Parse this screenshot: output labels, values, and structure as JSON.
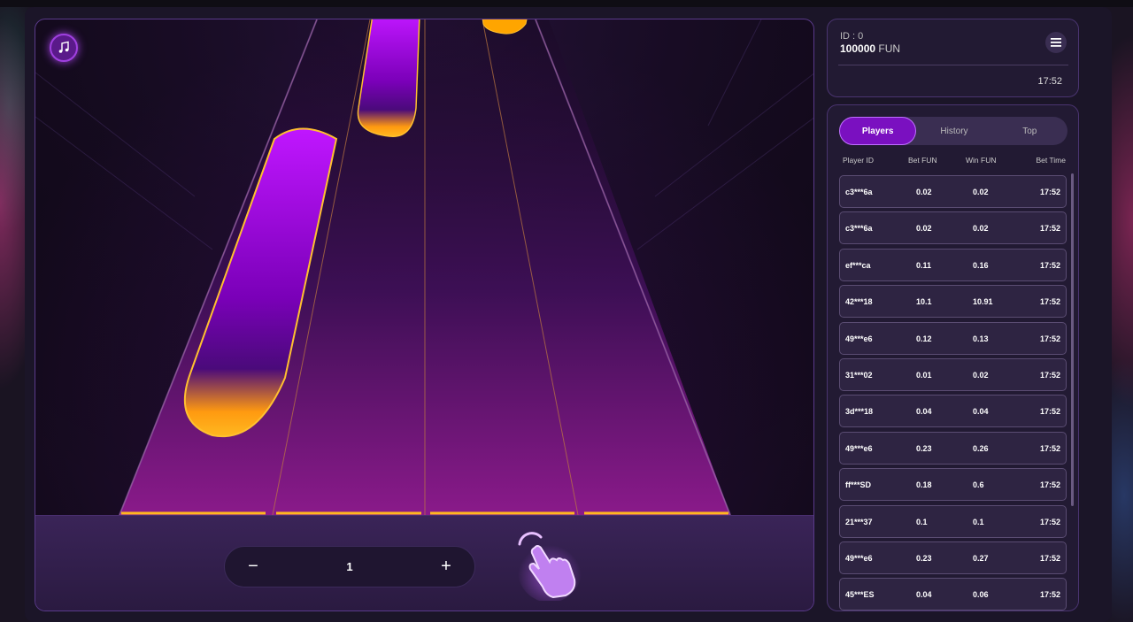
{
  "account": {
    "id": "ID : 0",
    "balance": "100000",
    "currency": "FUN",
    "time": "17:52"
  },
  "game": {
    "bet_value": "1",
    "minus_label": "−",
    "plus_label": "+"
  },
  "tabs": [
    {
      "label": "Players",
      "active": true
    },
    {
      "label": "History",
      "active": false
    },
    {
      "label": "Top",
      "active": false
    }
  ],
  "table": {
    "headers": {
      "player": "Player ID",
      "bet": "Bet  FUN",
      "win": "Win  FUN",
      "time": "Bet Time"
    },
    "rows": [
      {
        "player": "c3***6a",
        "bet": "0.02",
        "win": "0.02",
        "time": "17:52"
      },
      {
        "player": "c3***6a",
        "bet": "0.02",
        "win": "0.02",
        "time": "17:52"
      },
      {
        "player": "ef***ca",
        "bet": "0.11",
        "win": "0.16",
        "time": "17:52"
      },
      {
        "player": "42***18",
        "bet": "10.1",
        "win": "10.91",
        "time": "17:52"
      },
      {
        "player": "49***e6",
        "bet": "0.12",
        "win": "0.13",
        "time": "17:52"
      },
      {
        "player": "31***02",
        "bet": "0.01",
        "win": "0.02",
        "time": "17:52"
      },
      {
        "player": "3d***18",
        "bet": "0.04",
        "win": "0.04",
        "time": "17:52"
      },
      {
        "player": "49***e6",
        "bet": "0.23",
        "win": "0.26",
        "time": "17:52"
      },
      {
        "player": "ff***SD",
        "bet": "0.18",
        "win": "0.6",
        "time": "17:52"
      },
      {
        "player": "21***37",
        "bet": "0.1",
        "win": "0.1",
        "time": "17:52"
      },
      {
        "player": "49***e6",
        "bet": "0.23",
        "win": "0.27",
        "time": "17:52"
      },
      {
        "player": "45***ES",
        "bet": "0.04",
        "win": "0.06",
        "time": "17:52"
      }
    ]
  },
  "icons": {
    "music": "music-note-icon",
    "menu": "hamburger-menu-icon",
    "tap": "tap-hand-icon"
  },
  "colors": {
    "accent": "#7a10c0",
    "tile_glow": "#ffa800",
    "tile_body": "#a000e0"
  }
}
